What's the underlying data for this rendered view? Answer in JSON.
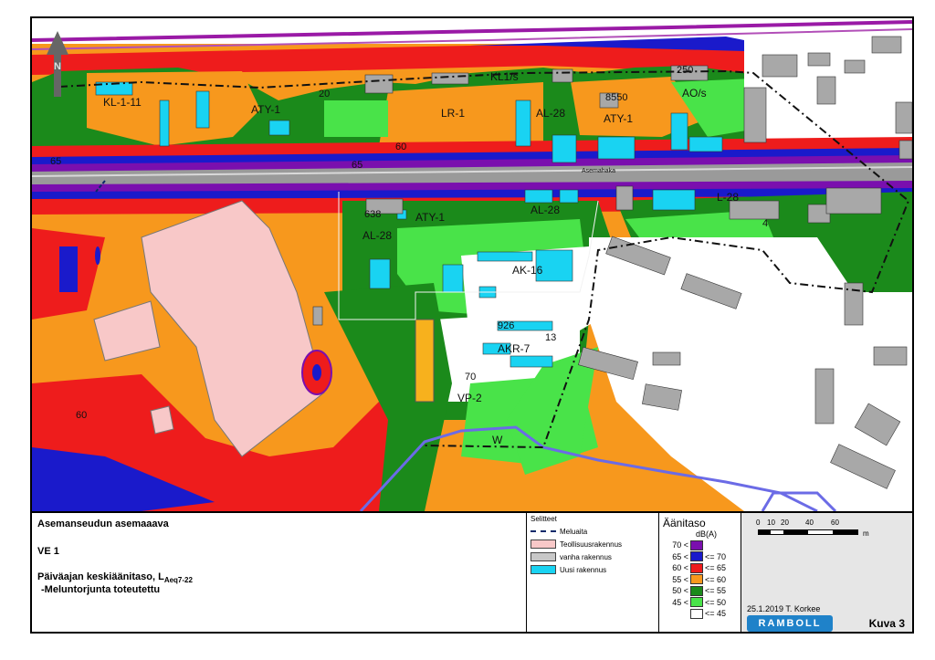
{
  "title_block": {
    "title": "Asemanseudun asemaaava",
    "variant": "VE 1",
    "subtitle_prefix": "Päiväajan keskiäänitaso, L",
    "subtitle_sub": "Aeq7-22",
    "subtitle_line2": "-Meluntorjunta toteutettu"
  },
  "symbols": {
    "title": "Selitteet",
    "items": [
      {
        "label": "Meluaita",
        "kind": "dash",
        "color": "#0a2a6a"
      },
      {
        "label": "Teollisuusrakennus",
        "kind": "fill",
        "color": "#f8c8c8"
      },
      {
        "label": "vanha rakennus",
        "kind": "fill",
        "color": "#c8c8c8"
      },
      {
        "label": "Uusi rakennus",
        "kind": "fill",
        "color": "#19d3f2"
      }
    ]
  },
  "noise_scale": {
    "title": "Äänitaso",
    "unit": "dB(A)",
    "bands": [
      {
        "lo": "70 <",
        "hi": "",
        "color": "#7a0fae"
      },
      {
        "lo": "65 <",
        "hi": "<= 70",
        "color": "#1a1acb"
      },
      {
        "lo": "60 <",
        "hi": "<= 65",
        "color": "#ee1c1c"
      },
      {
        "lo": "55 <",
        "hi": "<= 60",
        "color": "#f7981d"
      },
      {
        "lo": "50 <",
        "hi": "<= 55",
        "color": "#1b8a1b"
      },
      {
        "lo": "45 <",
        "hi": "<= 50",
        "color": "#49e349"
      },
      {
        "lo": "",
        "hi": "<= 45",
        "color": "#ffffff"
      }
    ]
  },
  "scalebar": {
    "ticks": [
      "0",
      "10",
      "20",
      "40",
      "60"
    ],
    "unit": "m"
  },
  "credit": "25.1.2019  T. Korkee",
  "logo": "RAMBOLL",
  "figure_label": "Kuva 3",
  "map": {
    "north_arrow": "N",
    "labels": [
      "KL-1-11",
      "ATY-1",
      "LR-1",
      "KL1/s",
      "AL-28",
      "ATY-1",
      "AO/s",
      "Asemahaka",
      "ATY-1",
      "AL-28",
      "AL-28",
      "L-28",
      "AK-16",
      "AKR-7",
      "VP-2",
      "W",
      "926",
      "13",
      "70",
      "638",
      "20",
      "60",
      "65",
      "65",
      "60",
      "4",
      "8550",
      "250"
    ]
  }
}
